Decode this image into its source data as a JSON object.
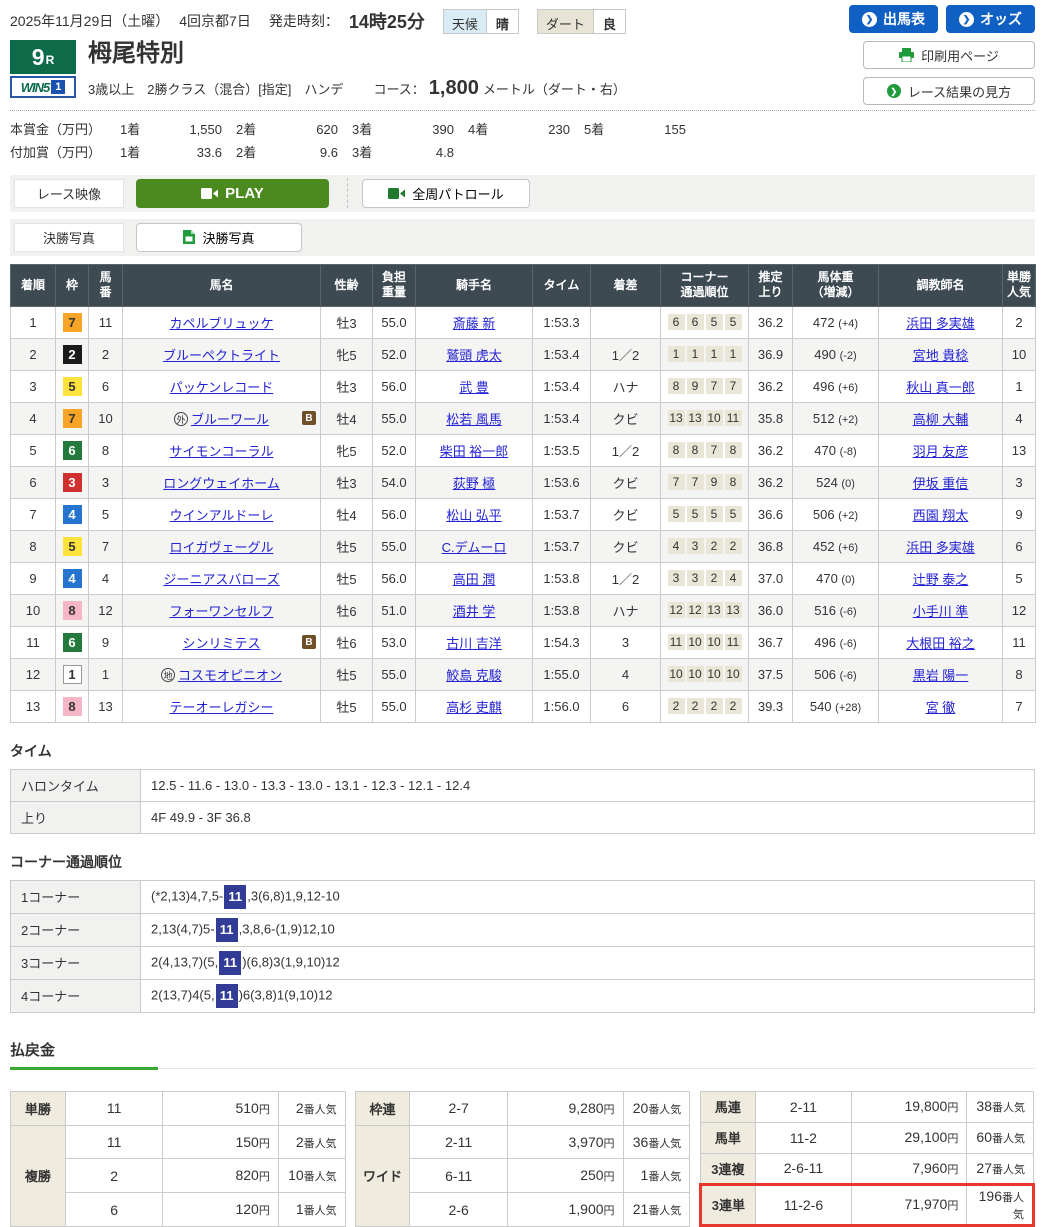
{
  "colors": {
    "accent_blue": "#1060c4",
    "header_slate": "#3d4a52",
    "race_green": "#0e6b4a",
    "play_green": "#4a8a1e",
    "underline_green": "#3aaa35",
    "highlight_red": "#e8372f",
    "corner_hl_blue": "#323b96"
  },
  "icons": {
    "arrow_circle": "❯",
    "camera": "video-camera",
    "printer": "printer",
    "document": "photo-document"
  },
  "header": {
    "date": "2025年11月29日（土曜）",
    "meeting": "4回京都7日",
    "start_label": "発走時刻：",
    "start_time": "14時25分",
    "weather_label": "天候",
    "weather_value": "晴",
    "track_label": "ダート",
    "track_value": "良",
    "btn_shutsuba": "出馬表",
    "btn_odds": "オッズ",
    "btn_print": "印刷用ページ",
    "btn_guide": "レース結果の見方"
  },
  "race": {
    "number": "9",
    "number_suffix": "R",
    "win5_text": "WIN5",
    "win5_num": "1",
    "title": "栂尾特別",
    "conditions": "3歳以上　2勝クラス（混合）[指定]　ハンデ",
    "course_label": "コース：",
    "course_value": "1,800",
    "course_unit": "メートル（ダート・右）"
  },
  "prizes": {
    "main_label": "本賞金（万円）",
    "main": [
      {
        "rank": "1着",
        "value": "1,550"
      },
      {
        "rank": "2着",
        "value": "620"
      },
      {
        "rank": "3着",
        "value": "390"
      },
      {
        "rank": "4着",
        "value": "230"
      },
      {
        "rank": "5着",
        "value": "155"
      }
    ],
    "added_label": "付加賞（万円）",
    "added": [
      {
        "rank": "1着",
        "value": "33.6"
      },
      {
        "rank": "2着",
        "value": "9.6"
      },
      {
        "rank": "3着",
        "value": "4.8"
      }
    ]
  },
  "media": {
    "race_video_label": "レース映像",
    "play_button": "PLAY",
    "patrol_button": "全周パトロール",
    "photo_label": "決勝写真",
    "photo_button": "決勝写真"
  },
  "results": {
    "headers": [
      [
        "着順"
      ],
      [
        "枠"
      ],
      [
        "馬",
        "番"
      ],
      [
        "馬名"
      ],
      [
        "性齢"
      ],
      [
        "負担",
        "重量"
      ],
      [
        "騎手名"
      ],
      [
        "タイム"
      ],
      [
        "着差"
      ],
      [
        "コーナー",
        "通過順位"
      ],
      [
        "推定",
        "上り"
      ],
      [
        "馬体重",
        "（増減）"
      ],
      [
        "調教師名"
      ],
      [
        "単勝",
        "人気"
      ]
    ],
    "rows": [
      {
        "pos": "1",
        "frame": "7",
        "num": "11",
        "mark": "",
        "horse": "カペルブリュッケ",
        "blinker": "",
        "sexage": "牡3",
        "weight": "55.0",
        "jockey": "斎藤 新",
        "time": "1:53.3",
        "margin": "",
        "corners": [
          "6",
          "6",
          "5",
          "5"
        ],
        "last3f": "36.2",
        "bw": "472",
        "bwdiff": "(+4)",
        "trainer": "浜田 多実雄",
        "fav": "2"
      },
      {
        "pos": "2",
        "frame": "2",
        "num": "2",
        "mark": "",
        "horse": "ブルーペクトライト",
        "blinker": "",
        "sexage": "牝5",
        "weight": "52.0",
        "jockey": "鷲頭 虎太",
        "time": "1:53.4",
        "margin": "1／2",
        "corners": [
          "1",
          "1",
          "1",
          "1"
        ],
        "last3f": "36.9",
        "bw": "490",
        "bwdiff": "(-2)",
        "trainer": "宮地 貴稔",
        "fav": "10"
      },
      {
        "pos": "3",
        "frame": "5",
        "num": "6",
        "mark": "",
        "horse": "パッケンレコード",
        "blinker": "",
        "sexage": "牡3",
        "weight": "56.0",
        "jockey": "武 豊",
        "time": "1:53.4",
        "margin": "ハナ",
        "corners": [
          "8",
          "9",
          "7",
          "7"
        ],
        "last3f": "36.2",
        "bw": "496",
        "bwdiff": "(+6)",
        "trainer": "秋山 真一郎",
        "fav": "1"
      },
      {
        "pos": "4",
        "frame": "7",
        "num": "10",
        "mark": "外",
        "horse": "ブルーワール",
        "blinker": "B",
        "sexage": "牡4",
        "weight": "55.0",
        "jockey": "松若 風馬",
        "time": "1:53.4",
        "margin": "クビ",
        "corners": [
          "13",
          "13",
          "10",
          "11"
        ],
        "last3f": "35.8",
        "bw": "512",
        "bwdiff": "(+2)",
        "trainer": "高柳 大輔",
        "fav": "4"
      },
      {
        "pos": "5",
        "frame": "6",
        "num": "8",
        "mark": "",
        "horse": "サイモンコーラル",
        "blinker": "",
        "sexage": "牝5",
        "weight": "52.0",
        "jockey": "柴田 裕一郎",
        "time": "1:53.5",
        "margin": "1／2",
        "corners": [
          "8",
          "8",
          "7",
          "8"
        ],
        "last3f": "36.2",
        "bw": "470",
        "bwdiff": "(-8)",
        "trainer": "羽月 友彦",
        "fav": "13"
      },
      {
        "pos": "6",
        "frame": "3",
        "num": "3",
        "mark": "",
        "horse": "ロングウェイホーム",
        "blinker": "",
        "sexage": "牡3",
        "weight": "54.0",
        "jockey": "荻野 極",
        "time": "1:53.6",
        "margin": "クビ",
        "corners": [
          "7",
          "7",
          "9",
          "8"
        ],
        "last3f": "36.2",
        "bw": "524",
        "bwdiff": "(0)",
        "trainer": "伊坂 重信",
        "fav": "3"
      },
      {
        "pos": "7",
        "frame": "4",
        "num": "5",
        "mark": "",
        "horse": "ウインアルドーレ",
        "blinker": "",
        "sexage": "牡4",
        "weight": "56.0",
        "jockey": "松山 弘平",
        "time": "1:53.7",
        "margin": "クビ",
        "corners": [
          "5",
          "5",
          "5",
          "5"
        ],
        "last3f": "36.6",
        "bw": "506",
        "bwdiff": "(+2)",
        "trainer": "西園 翔太",
        "fav": "9"
      },
      {
        "pos": "8",
        "frame": "5",
        "num": "7",
        "mark": "",
        "horse": "ロイガヴェーグル",
        "blinker": "",
        "sexage": "牡5",
        "weight": "55.0",
        "jockey": "C.デムーロ",
        "time": "1:53.7",
        "margin": "クビ",
        "corners": [
          "4",
          "3",
          "2",
          "2"
        ],
        "last3f": "36.8",
        "bw": "452",
        "bwdiff": "(+6)",
        "trainer": "浜田 多実雄",
        "fav": "6"
      },
      {
        "pos": "9",
        "frame": "4",
        "num": "4",
        "mark": "",
        "horse": "ジーニアスバローズ",
        "blinker": "",
        "sexage": "牡5",
        "weight": "56.0",
        "jockey": "高田 潤",
        "time": "1:53.8",
        "margin": "1／2",
        "corners": [
          "3",
          "3",
          "2",
          "4"
        ],
        "last3f": "37.0",
        "bw": "470",
        "bwdiff": "(0)",
        "trainer": "辻野 泰之",
        "fav": "5"
      },
      {
        "pos": "10",
        "frame": "8",
        "num": "12",
        "mark": "",
        "horse": "フォーワンセルフ",
        "blinker": "",
        "sexage": "牡6",
        "weight": "51.0",
        "jockey": "酒井 学",
        "time": "1:53.8",
        "margin": "ハナ",
        "corners": [
          "12",
          "12",
          "13",
          "13"
        ],
        "last3f": "36.0",
        "bw": "516",
        "bwdiff": "(-6)",
        "trainer": "小手川 準",
        "fav": "12"
      },
      {
        "pos": "11",
        "frame": "6",
        "num": "9",
        "mark": "",
        "horse": "シンリミテス",
        "blinker": "B",
        "sexage": "牡6",
        "weight": "53.0",
        "jockey": "古川 吉洋",
        "time": "1:54.3",
        "margin": "3",
        "corners": [
          "11",
          "10",
          "10",
          "11"
        ],
        "last3f": "36.7",
        "bw": "496",
        "bwdiff": "(-6)",
        "trainer": "大根田 裕之",
        "fav": "11"
      },
      {
        "pos": "12",
        "frame": "1",
        "num": "1",
        "mark": "地",
        "horse": "コスモオピニオン",
        "blinker": "",
        "sexage": "牡5",
        "weight": "55.0",
        "jockey": "鮫島 克駿",
        "time": "1:55.0",
        "margin": "4",
        "corners": [
          "10",
          "10",
          "10",
          "10"
        ],
        "last3f": "37.5",
        "bw": "506",
        "bwdiff": "(-6)",
        "trainer": "黒岩 陽一",
        "fav": "8"
      },
      {
        "pos": "13",
        "frame": "8",
        "num": "13",
        "mark": "",
        "horse": "テーオーレガシー",
        "blinker": "",
        "sexage": "牡5",
        "weight": "55.0",
        "jockey": "高杉 吏麒",
        "time": "1:56.0",
        "margin": "6",
        "corners": [
          "2",
          "2",
          "2",
          "2"
        ],
        "last3f": "39.3",
        "bw": "540",
        "bwdiff": "(+28)",
        "trainer": "宮 徹",
        "fav": "7"
      }
    ],
    "frame_colors": {
      "1": {
        "bg": "#ffffff",
        "fg": "#333333",
        "border": "#999999"
      },
      "2": {
        "bg": "#1a1a1a",
        "fg": "#ffffff",
        "border": "#1a1a1a"
      },
      "3": {
        "bg": "#d03030",
        "fg": "#ffffff",
        "border": "#d03030"
      },
      "4": {
        "bg": "#2575d0",
        "fg": "#ffffff",
        "border": "#2575d0"
      },
      "5": {
        "bg": "#ffe33c",
        "fg": "#333333",
        "border": "#ffe33c"
      },
      "6": {
        "bg": "#237a3c",
        "fg": "#ffffff",
        "border": "#237a3c"
      },
      "7": {
        "bg": "#f7a427",
        "fg": "#333333",
        "border": "#f7a427"
      },
      "8": {
        "bg": "#f5b6c8",
        "fg": "#333333",
        "border": "#f5b6c8"
      }
    }
  },
  "time_section": {
    "title": "タイム",
    "rows": [
      {
        "label": "ハロンタイム",
        "value": "12.5 - 11.6 - 13.0 - 13.3 - 13.0 - 13.1 - 12.3 - 12.1 - 12.4"
      },
      {
        "label": "上り",
        "value": "4F 49.9 - 3F 36.8"
      }
    ]
  },
  "corner_section": {
    "title": "コーナー通過順位",
    "highlight": "11",
    "rows": [
      {
        "label": "1コーナー",
        "pre": "(*2,13)4,7,5-",
        "post": ",3(6,8)1,9,12-10"
      },
      {
        "label": "2コーナー",
        "pre": "2,13(4,7)5-",
        "post": ",3,8,6-(1,9)12,10"
      },
      {
        "label": "3コーナー",
        "pre": "2(4,13,7)(5,",
        "post": ")(6,8)3(1,9,10)12"
      },
      {
        "label": "4コーナー",
        "pre": "2(13,7)4(5,",
        "post": ")6(3,8)1(9,10)12"
      }
    ]
  },
  "payouts": {
    "title": "払戻金",
    "yen_unit": "円",
    "fav_unit": "番人気",
    "groups": [
      [
        {
          "type": "単勝",
          "rows": [
            {
              "combo": "11",
              "pay": "510",
              "fav": "2"
            }
          ]
        },
        {
          "type": "複勝",
          "rows": [
            {
              "combo": "11",
              "pay": "150",
              "fav": "2"
            },
            {
              "combo": "2",
              "pay": "820",
              "fav": "10"
            },
            {
              "combo": "6",
              "pay": "120",
              "fav": "1"
            }
          ]
        }
      ],
      [
        {
          "type": "枠連",
          "rows": [
            {
              "combo": "2-7",
              "pay": "9,280",
              "fav": "20"
            }
          ]
        },
        {
          "type": "ワイド",
          "rows": [
            {
              "combo": "2-11",
              "pay": "3,970",
              "fav": "36"
            },
            {
              "combo": "6-11",
              "pay": "250",
              "fav": "1"
            },
            {
              "combo": "2-6",
              "pay": "1,900",
              "fav": "21"
            }
          ]
        }
      ],
      [
        {
          "type": "馬連",
          "rows": [
            {
              "combo": "2-11",
              "pay": "19,800",
              "fav": "38"
            }
          ]
        },
        {
          "type": "馬単",
          "rows": [
            {
              "combo": "11-2",
              "pay": "29,100",
              "fav": "60"
            }
          ]
        },
        {
          "type": "3連複",
          "rows": [
            {
              "combo": "2-6-11",
              "pay": "7,960",
              "fav": "27"
            }
          ]
        },
        {
          "type": "3連単",
          "highlight": true,
          "rows": [
            {
              "combo": "11-2-6",
              "pay": "71,970",
              "fav": "196"
            }
          ]
        }
      ]
    ]
  }
}
